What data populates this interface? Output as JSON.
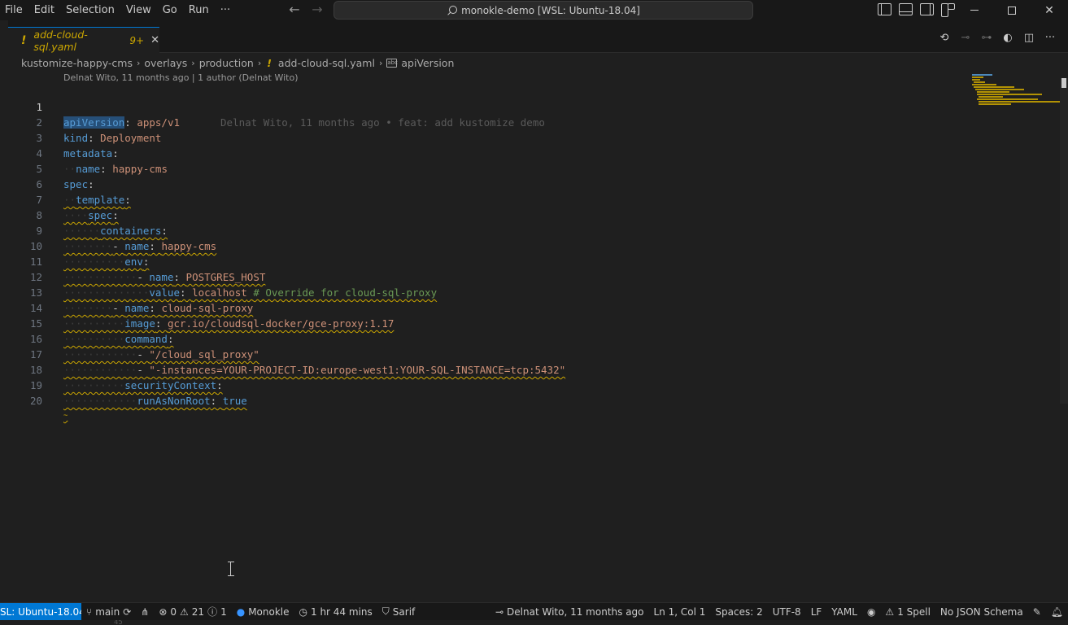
{
  "menu": {
    "items": [
      "File",
      "Edit",
      "Selection",
      "View",
      "Go",
      "Run",
      "···"
    ]
  },
  "command_center": {
    "label": "monokle-demo [WSL: Ubuntu-18.04]"
  },
  "tab": {
    "title": "add-cloud-sql.yaml",
    "badge": "9+",
    "modified_marker": "!"
  },
  "breadcrumb": {
    "items": [
      "kustomize-happy-cms",
      "overlays",
      "production",
      "add-cloud-sql.yaml",
      "apiVersion"
    ]
  },
  "codelens": "Delnat Wito, 11 months ago | 1 author (Delnat Wito)",
  "inline_blame": "Delnat Wito, 11 months ago • feat: add kustomize demo",
  "code": {
    "line_numbers": [
      "1",
      "2",
      "3",
      "4",
      "5",
      "6",
      "7",
      "8",
      "9",
      "10",
      "11",
      "12",
      "13",
      "14",
      "15",
      "16",
      "17",
      "18",
      "19",
      "20"
    ],
    "l1": {
      "key": "apiVersion",
      "value": "apps/v1"
    },
    "l2": {
      "key": "kind",
      "value": "Deployment"
    },
    "l3": {
      "key": "metadata"
    },
    "l4": {
      "key": "name",
      "value": "happy-cms"
    },
    "l5": {
      "key": "spec"
    },
    "l6": {
      "key": "template"
    },
    "l7": {
      "key": "spec"
    },
    "l8": {
      "key": "containers"
    },
    "l9": {
      "key": "name",
      "value": "happy-cms"
    },
    "l10": {
      "key": "env"
    },
    "l11": {
      "key": "name",
      "value": "POSTGRES_HOST"
    },
    "l12": {
      "key": "value",
      "value": "localhost",
      "comment": "# Override for cloud-sql-proxy"
    },
    "l13": {
      "key": "name",
      "value": "cloud-sql-proxy"
    },
    "l14": {
      "key": "image",
      "value": "gcr.io/cloudsql-docker/gce-proxy:1.17"
    },
    "l15": {
      "key": "command"
    },
    "l16": {
      "value": "\"/cloud_sql_proxy\""
    },
    "l17": {
      "value": "\"-instances=YOUR-PROJECT-ID:europe-west1:YOUR-SQL-INSTANCE=tcp:5432\""
    },
    "l18": {
      "key": "securityContext"
    },
    "l19": {
      "key": "runAsNonRoot",
      "value": "true"
    }
  },
  "statusbar": {
    "remote": "SL: Ubuntu-18.04",
    "branch": "main",
    "errors": "0",
    "warnings": "21",
    "infos": "1",
    "monokle": "Monokle",
    "time": "1 hr 44 mins",
    "sarif": "Sarif",
    "blame": "Delnat Wito, 11 months ago",
    "position": "Ln 1, Col 1",
    "spaces": "Spaces: 2",
    "encoding": "UTF-8",
    "eol": "LF",
    "language": "YAML",
    "spell": "1 Spell",
    "schema": "No JSON Schema"
  },
  "below_status": "45",
  "colors": {
    "accent": "#0078d4",
    "warning": "#cca700",
    "key": "#569cd6",
    "string": "#ce9178",
    "comment": "#6a9955"
  }
}
